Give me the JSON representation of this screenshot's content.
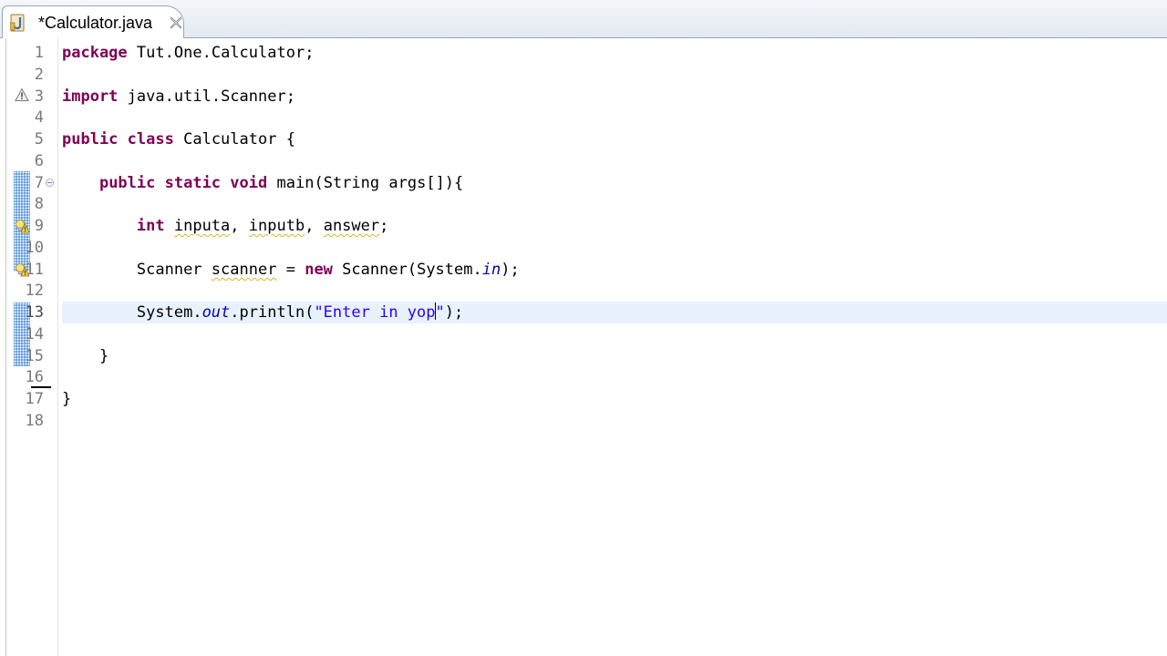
{
  "tab": {
    "title": "*Calculator.java",
    "icon": "java-file-icon",
    "close_icon": "close-icon"
  },
  "editor": {
    "lines": [
      {
        "n": "1",
        "text": "package Tut.One.Calculator;"
      },
      {
        "n": "2",
        "text": ""
      },
      {
        "n": "3",
        "text": "import java.util.Scanner;"
      },
      {
        "n": "4",
        "text": ""
      },
      {
        "n": "5",
        "text": "public class Calculator {"
      },
      {
        "n": "6",
        "text": ""
      },
      {
        "n": "7",
        "text": "    public static void main(String args[]){"
      },
      {
        "n": "8",
        "text": ""
      },
      {
        "n": "9",
        "text": "        int inputa, inputb, answer;"
      },
      {
        "n": "10",
        "text": ""
      },
      {
        "n": "11",
        "text": "        Scanner scanner = new Scanner(System.in);"
      },
      {
        "n": "12",
        "text": ""
      },
      {
        "n": "13",
        "text": "        System.out.println(\"Enter in yop\");"
      },
      {
        "n": "14",
        "text": ""
      },
      {
        "n": "15",
        "text": "    }"
      },
      {
        "n": "16",
        "text": ""
      },
      {
        "n": "17",
        "text": "}"
      },
      {
        "n": "18",
        "text": ""
      }
    ],
    "current_line": "13",
    "colors": {
      "keyword": "#7f0055",
      "string": "#2a00ff",
      "static_field": "#0000c0",
      "line_number": "#7a7a7a",
      "current_line_highlight": "#e8f2fe",
      "change_bar": "#4f8fd8",
      "warning_underline": "#d7b429"
    },
    "ruler_markers": [
      {
        "line": "3",
        "icon": "warning-icon"
      },
      {
        "line": "9",
        "icon": "warning-lightbulb-icon"
      },
      {
        "line": "11",
        "icon": "warning-lightbulb-icon"
      },
      {
        "line": "7",
        "icon": "fold-collapse-icon"
      }
    ]
  }
}
